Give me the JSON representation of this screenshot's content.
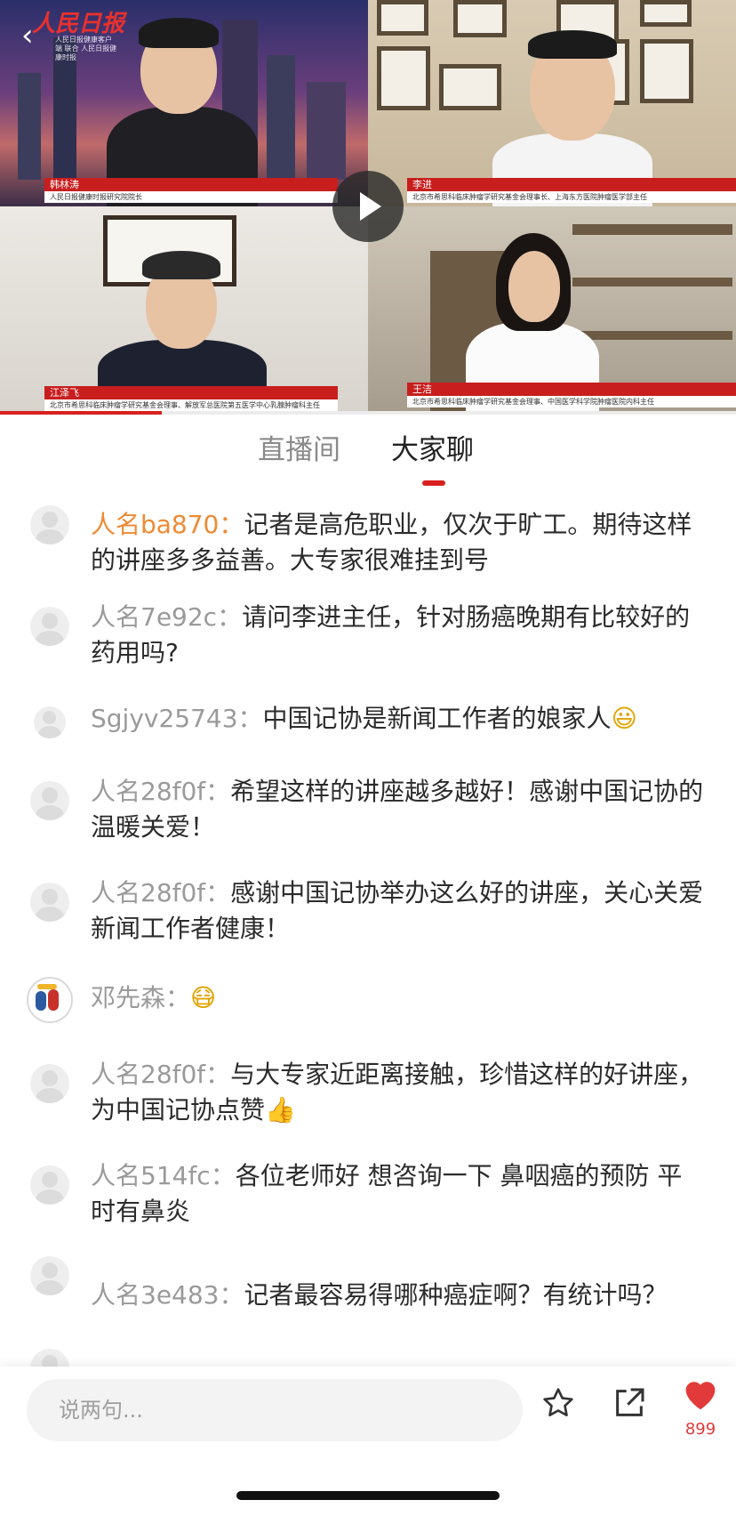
{
  "video": {
    "logo": "人民日报",
    "logo_sub": "人民日报健康客户端 联合 人民日报健康时报",
    "progress": 0.22,
    "speakers": [
      {
        "name": "韩林涛",
        "title": "人民日报健康时报研究院院长"
      },
      {
        "name": "李进",
        "title": "北京市希思科临床肿瘤学研究基金会理事长、上海东方医院肿瘤医学部主任"
      },
      {
        "name": "江泽飞",
        "title": "北京市希思科临床肿瘤学研究基金会理事、解放军总医院第五医学中心乳腺肿瘤科主任"
      },
      {
        "name": "王洁",
        "title": "北京市希思科临床肿瘤学研究基金会理事、中国医学科学院肿瘤医院内科主任"
      }
    ]
  },
  "tabs": {
    "live": "直播间",
    "chat": "大家聊",
    "active": "chat"
  },
  "messages": [
    {
      "user": "人名ba870：",
      "text": "记者是高危职业，仅次于旷工。期待这样的讲座多多益善。大专家很难挂到号",
      "highlight": true
    },
    {
      "user": "人名7e92c：",
      "text": "请问李进主任，针对肠癌晚期有比较好的药用吗?"
    },
    {
      "user": "Sgjyv25743：",
      "text": "中国记协是新闻工作者的娘家人",
      "emoji": "😃"
    },
    {
      "user": "人名28f0f：",
      "text": "希望这样的讲座越多越好！感谢中国记协的温暖关爱！"
    },
    {
      "user": "人名28f0f：",
      "text": "感谢中国记协举办这么好的讲座，关心关爱新闻工作者健康！"
    },
    {
      "user": "邓先森：",
      "text": "",
      "emoji": "😷"
    },
    {
      "user": "人名28f0f：",
      "text": "与大专家近距离接触，珍惜这样的好讲座，为中国记协点赞",
      "emoji": "👍"
    },
    {
      "user": "人名514fc：",
      "text": "各位老师好 想咨询一下 鼻咽癌的预防 平时有鼻炎"
    },
    {
      "user": "人名3e483：",
      "text": "记者最容易得哪种癌症啊？有统计吗？"
    }
  ],
  "bottom": {
    "placeholder": "说两句...",
    "icons": {
      "favorite": "star-icon",
      "share": "share-icon",
      "like": "heart-icon"
    },
    "like_count": "899",
    "like_color": "#e23a3a"
  },
  "colors": {
    "accent": "#d8211e",
    "username_highlight": "#ef8a34",
    "username": "#9a9a9a"
  }
}
